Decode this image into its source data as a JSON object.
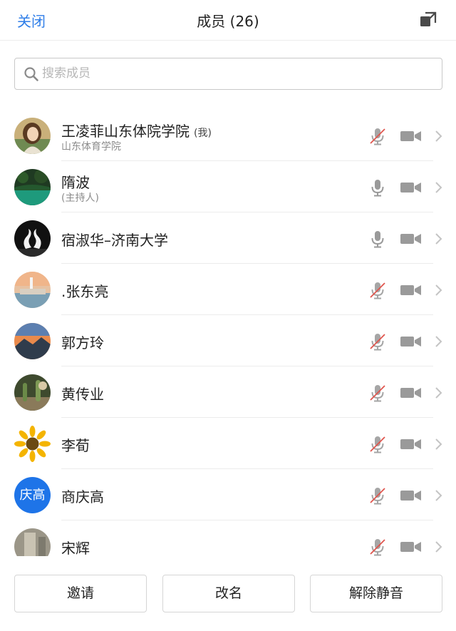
{
  "header": {
    "close_label": "关闭",
    "title": "成员 (26)",
    "expand_icon": "expand-icon"
  },
  "search": {
    "placeholder": "搜索成员",
    "value": ""
  },
  "members": [
    {
      "name": "王凌菲山东体院学院",
      "tag": "(我)",
      "subtitle": "山东体育学院",
      "avatar": "portrait-photo",
      "mic_muted": true
    },
    {
      "name": "隋波",
      "tag": "",
      "subtitle": "(主持人)",
      "avatar": "lake-photo",
      "mic_muted": false
    },
    {
      "name": "宿淑华–济南大学",
      "tag": "",
      "subtitle": "",
      "avatar": "swans-photo",
      "mic_muted": false
    },
    {
      "name": ".张东亮",
      "tag": "",
      "subtitle": "",
      "avatar": "lighthouse-photo",
      "mic_muted": true
    },
    {
      "name": "郭方玲",
      "tag": "",
      "subtitle": "",
      "avatar": "sunset-mountain-photo",
      "mic_muted": true
    },
    {
      "name": "黄传业",
      "tag": "",
      "subtitle": "",
      "avatar": "cactus-photo",
      "mic_muted": true
    },
    {
      "name": "李荀",
      "tag": "",
      "subtitle": "",
      "avatar": "sunflower-photo",
      "mic_muted": true
    },
    {
      "name": "商庆高",
      "tag": "",
      "subtitle": "",
      "avatar": "text-avatar",
      "avatar_text": "庆高",
      "avatar_color": "#1e74e8",
      "mic_muted": true
    },
    {
      "name": "宋辉",
      "tag": "",
      "subtitle": "",
      "avatar": "stone-photo",
      "mic_muted": true
    }
  ],
  "footer": {
    "invite_label": "邀请",
    "rename_label": "改名",
    "unmute_label": "解除静音"
  },
  "colors": {
    "accent": "#2f7ee8",
    "icon_gray": "#9a9a9a",
    "mute_red": "#e0554d",
    "avatar_blue": "#1e74e8"
  }
}
